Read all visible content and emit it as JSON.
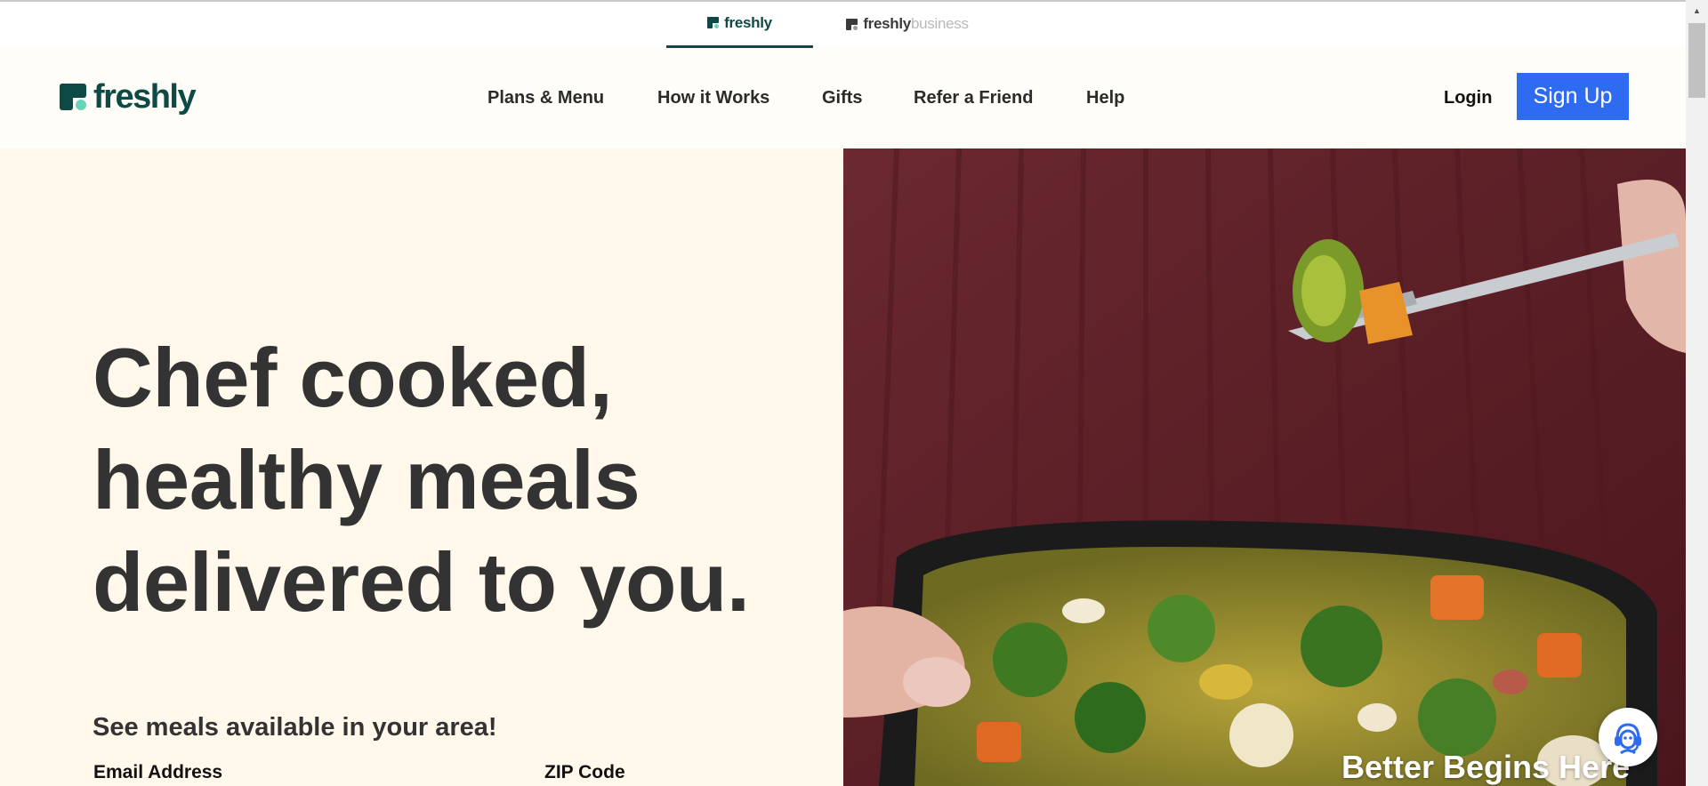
{
  "switcher": {
    "tabs": [
      {
        "brand": "freshly",
        "suffix": ""
      },
      {
        "brand": "freshly",
        "suffix": "business"
      }
    ]
  },
  "header": {
    "logo_text": "freshly",
    "nav": [
      "Plans & Menu",
      "How it Works",
      "Gifts",
      "Refer a Friend",
      "Help"
    ],
    "login_label": "Login",
    "signup_label": "Sign Up"
  },
  "hero": {
    "headline_lines": [
      "Chef cooked,",
      "healthy meals",
      "delivered to you."
    ],
    "subhead": "See meals available in your area!",
    "email_label": "Email Address",
    "zip_label": "ZIP Code",
    "image_tagline": "Better Begins Here"
  },
  "colors": {
    "brand_green": "#0d4a45",
    "accent_mint": "#6ad3b8",
    "signup_blue": "#2f6bf0",
    "hero_bg": "#fff8eb",
    "header_bg": "#fffdf7",
    "headline_text": "#333333"
  },
  "icons": {
    "brand_logo": "freshly-logo-icon",
    "chat": "support-agent-icon"
  }
}
